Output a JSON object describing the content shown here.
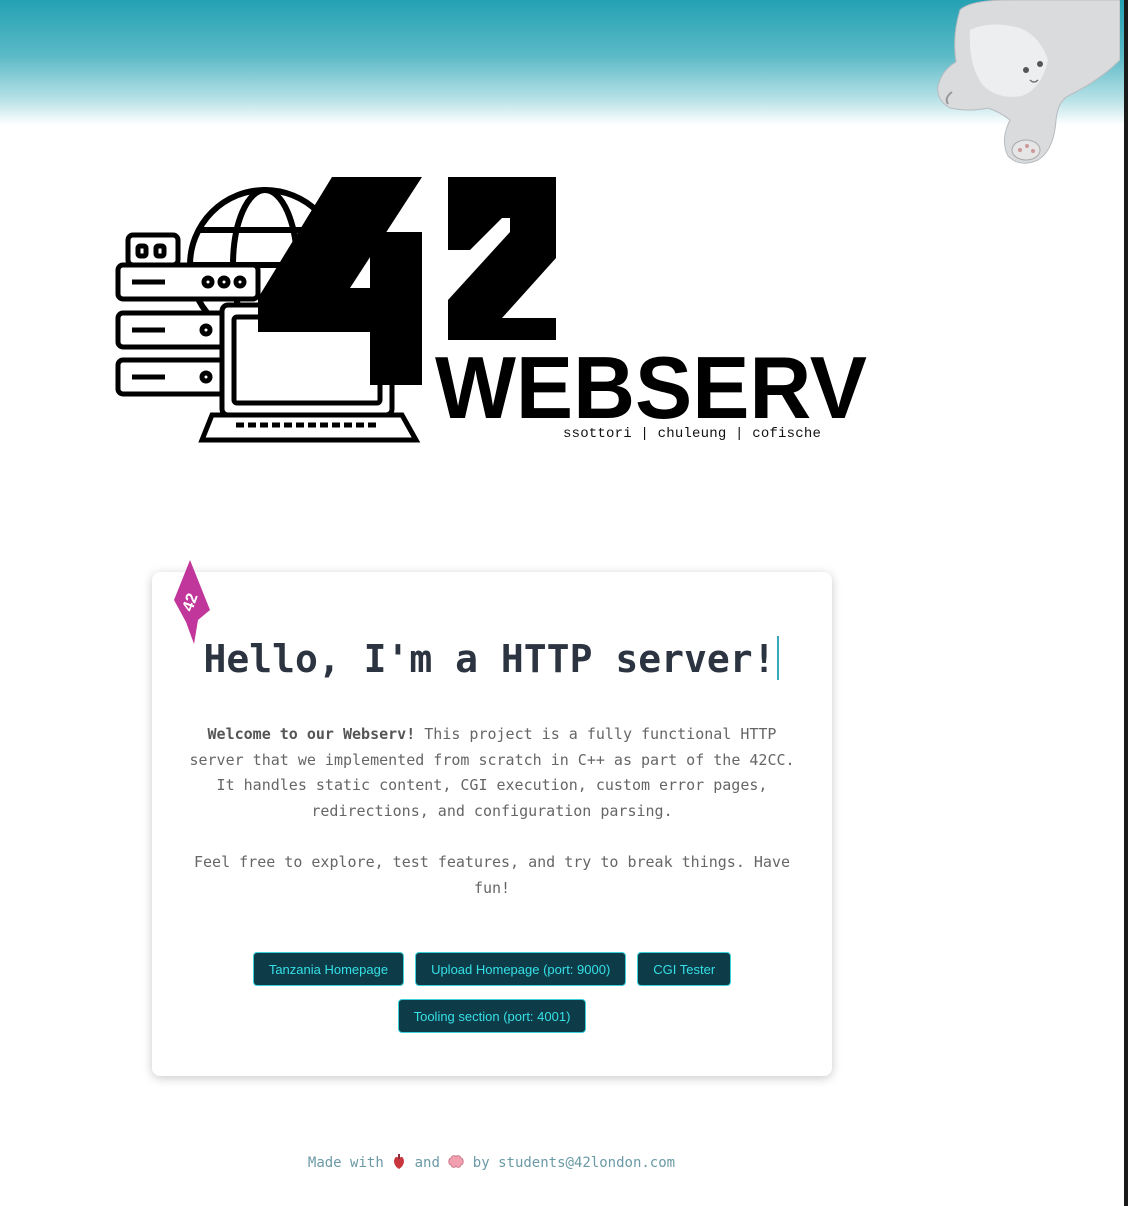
{
  "logo": {
    "number": "42",
    "wordmark": "WEBSERV",
    "credits": "ssottori | chuleung | cofische"
  },
  "sticker": {
    "text": "42"
  },
  "card": {
    "headline": "Hello, I'm a HTTP server!",
    "intro_bold": "Welcome to our Webserv!",
    "intro_text": " This project is a fully functional HTTP server that we implemented from scratch in C++ as part of the 42CC. It handles static content, CGI execution, custom error pages, redirections, and configuration parsing.",
    "note": "Feel free to explore, test features, and try to break things. Have fun!"
  },
  "buttons": [
    {
      "label": "Tanzania Homepage"
    },
    {
      "label": "Upload Homepage (port: 9000)"
    },
    {
      "label": "CGI Tester"
    },
    {
      "label": "Tooling section (port: 4001)"
    }
  ],
  "footer": {
    "prefix": "Made with",
    "heart_icon": "anatomical-heart-icon",
    "middle": "and",
    "brain_icon": "brain-icon",
    "suffix": "by students@42london.com"
  },
  "colors": {
    "accent_teal": "#23a1b3",
    "button_bg": "#0e3b48",
    "button_text": "#35e0e6",
    "sticker": "#c0369a",
    "headline": "#2b3440"
  }
}
